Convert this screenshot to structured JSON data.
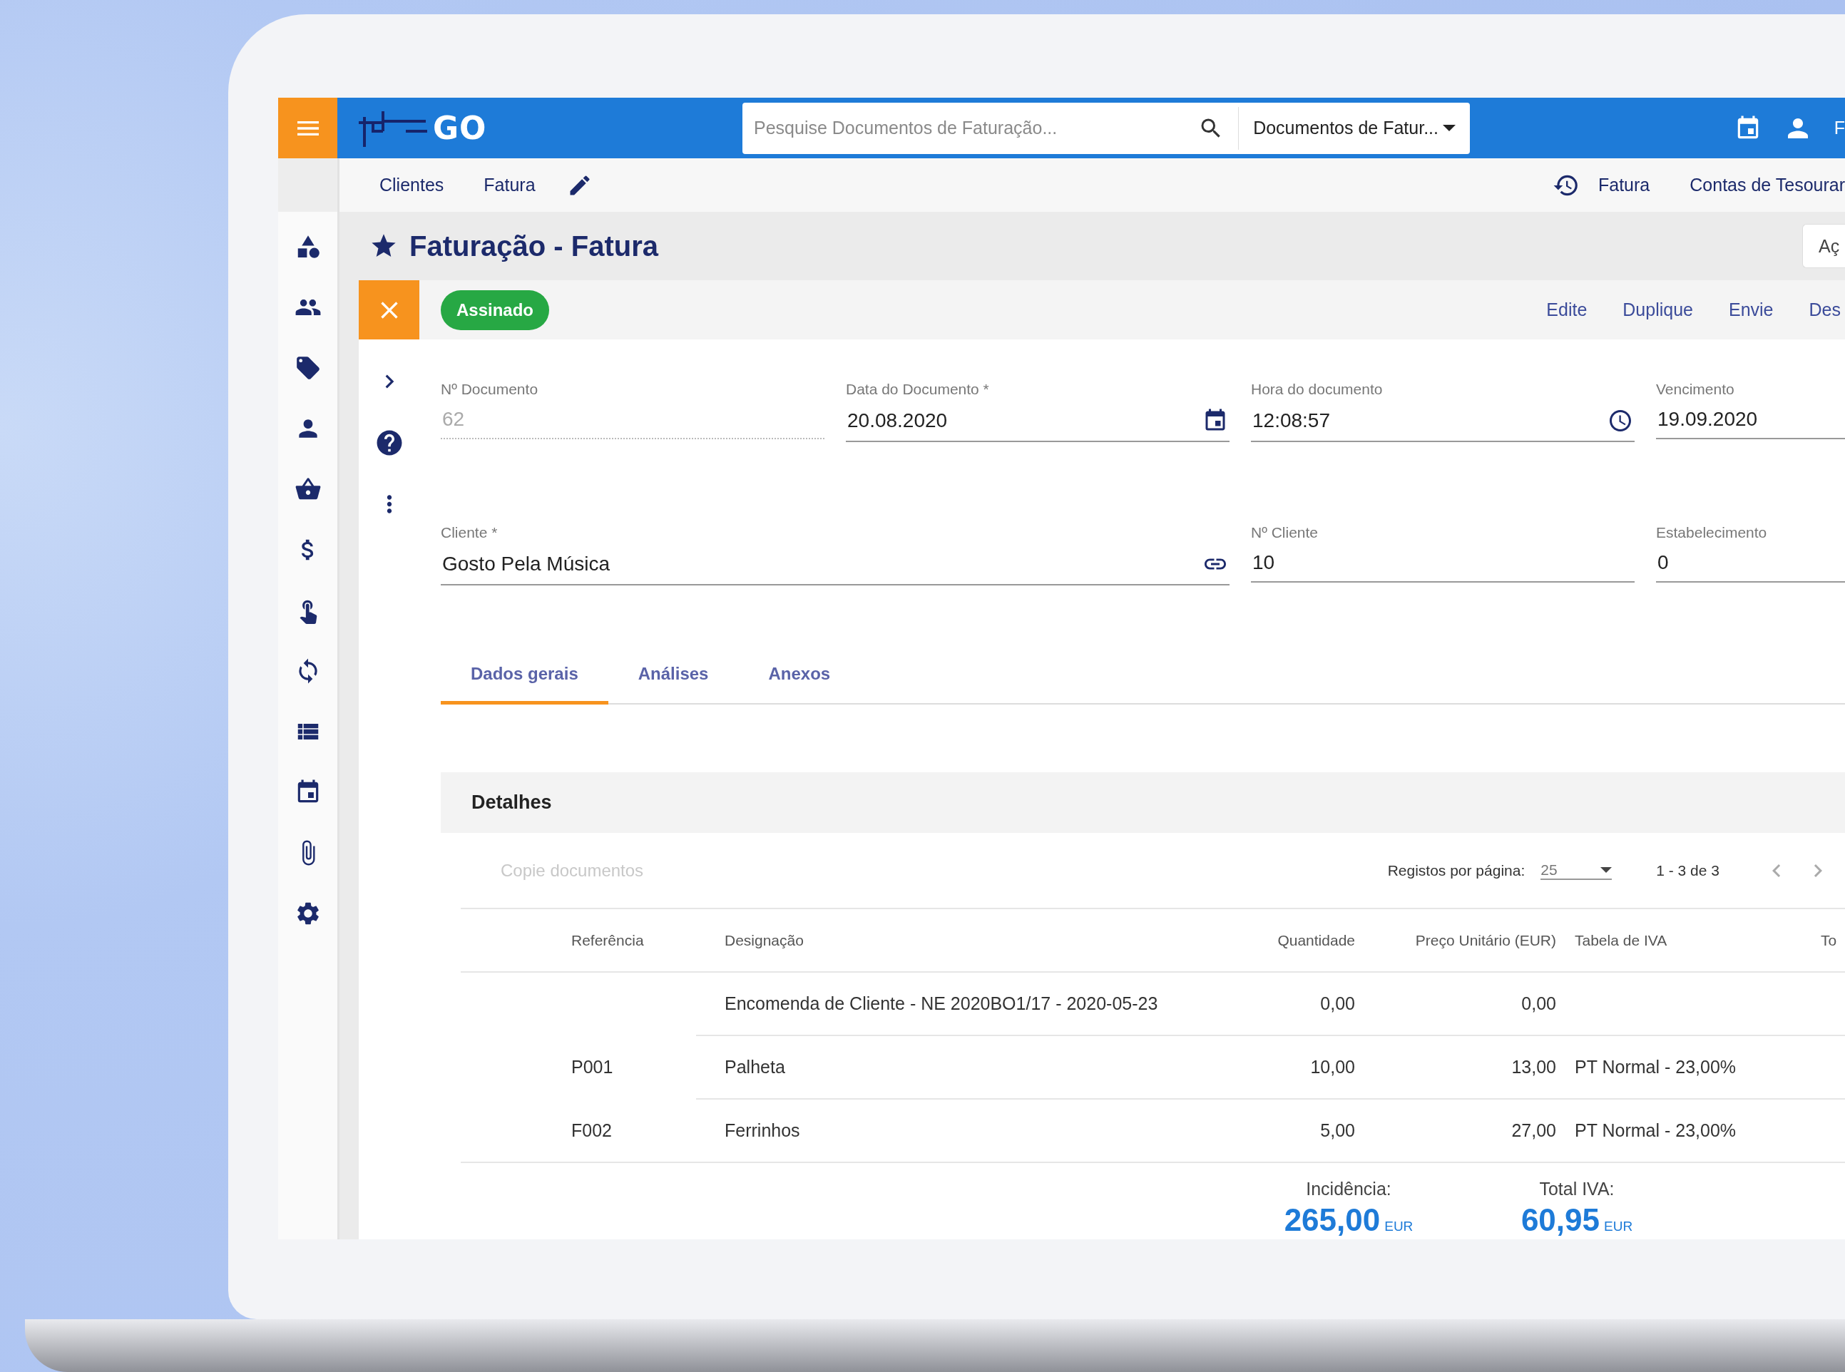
{
  "top_bar": {
    "logo_text": "GO",
    "search": {
      "placeholder": "Pesquise Documentos de Faturação..."
    },
    "document_type": {
      "value": "Documentos de Fatur..."
    },
    "user_label": "F"
  },
  "breadcrumbs": [
    {
      "label": "Clientes"
    },
    {
      "label": "Fatura"
    }
  ],
  "recent": [
    {
      "label": "Fatura"
    },
    {
      "label": "Contas de Tesourar"
    }
  ],
  "page_title": "Faturação - Fatura",
  "actions_button": "Aç",
  "status_badge": "Assinado",
  "actions": [
    "Edite",
    "Duplique",
    "Envie",
    "Des"
  ],
  "field_rows": [
    [
      {
        "label": "Nº Documento",
        "value": "62",
        "kind": "readonly"
      },
      {
        "label": "Data do Documento *",
        "value": "20.08.2020",
        "kind": "date"
      },
      {
        "label": "Hora do documento",
        "value": "12:08:57",
        "kind": "time"
      },
      {
        "label": "Vencimento",
        "value": "19.09.2020",
        "kind": "text"
      }
    ],
    [
      {
        "label": "Cliente *",
        "value": "Gosto Pela Música",
        "kind": "link",
        "wide": true
      },
      {
        "label": "Nº Cliente",
        "value": "10",
        "kind": "text"
      },
      {
        "label": "Estabelecimento",
        "value": "0",
        "kind": "text"
      }
    ]
  ],
  "tabs": [
    {
      "label": "Dados gerais",
      "selected": true
    },
    {
      "label": "Análises",
      "selected": false
    },
    {
      "label": "Anexos",
      "selected": false
    }
  ],
  "details": {
    "title": "Detalhes",
    "copy_button": {
      "label": "Copie documentos",
      "disabled": true
    },
    "pagination": {
      "label": "Registos por página:",
      "page_size": "25",
      "range": "1 - 3 de 3"
    },
    "columns": [
      "Referência",
      "Designação",
      "Quantidade",
      "Preço Unitário (EUR)",
      "Tabela de IVA",
      "To"
    ],
    "rows": [
      {
        "designation": "Encomenda de Cliente - NE 2020BO1/17 - 2020-05-23",
        "quantity": "0,00",
        "unit_price": "0,00"
      },
      {
        "reference": "P001",
        "designation": "Palheta",
        "quantity": "10,00",
        "unit_price": "13,00",
        "vat_table": "PT Normal - 23,00%"
      },
      {
        "reference": "F002",
        "designation": "Ferrinhos",
        "quantity": "5,00",
        "unit_price": "27,00",
        "vat_table": "PT Normal - 23,00%"
      }
    ],
    "totals": [
      {
        "label": "Incidência:",
        "amount": "265,00",
        "currency": "EUR"
      },
      {
        "label": "Total IVA:",
        "amount": "60,95",
        "currency": "EUR"
      }
    ]
  }
}
